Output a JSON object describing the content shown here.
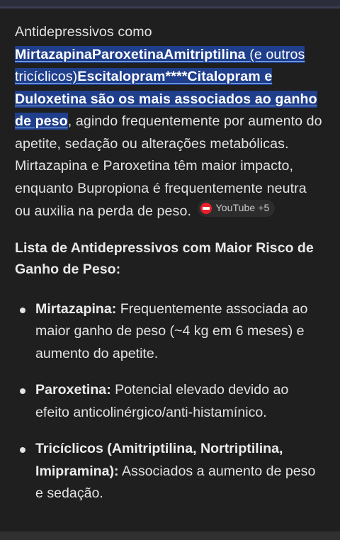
{
  "intro": {
    "lead": "Antidepressivos como ",
    "highlight_bold_1": "MirtazapinaParoxetinaAmitriptilina",
    "highlight_plain": " (e outros tricíclicos)",
    "highlight_bold_2": "Escitalopram****Citalopram e Duloxetina são os mais associados ao ganho de peso",
    "rest": ", agindo frequentemente por aumento do apetite, sedação ou alterações metabólicas. Mirtazapina e Paroxetina têm maior impacto, enquanto Bupropiona é frequentemente neutra ou auxilia na perda de peso."
  },
  "source_chip": {
    "label": "YouTube +5",
    "icon": "youtube-icon",
    "icon_color": "#e8202a"
  },
  "section_title": "Lista de Antidepressivos com Maior Risco de Ganho de Peso:",
  "items": [
    {
      "name": "Mirtazapina:",
      "text": " Frequentemente associada ao maior ganho de peso (~4 kg em 6 meses) e aumento do apetite."
    },
    {
      "name": "Paroxetina:",
      "text": " Potencial elevado devido ao efeito anticolinérgico/anti-histamínico."
    },
    {
      "name": "Tricíclicos (Amitriptilina, Nortriptilina, Imipramina):",
      "text": " Associados a aumento de peso e sedação."
    }
  ],
  "colors": {
    "background": "#1f1f1f",
    "highlight": "#1f3f8c",
    "text": "#e3e3e3"
  }
}
